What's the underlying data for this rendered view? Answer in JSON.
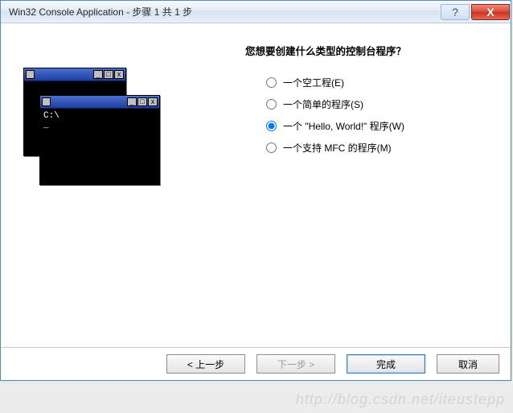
{
  "titlebar": {
    "title": "Win32 Console Application - 步骤 1 共 1 步",
    "help": "?",
    "close": "X"
  },
  "prompt": "您想要创建什么类型的控制台程序？",
  "options": [
    {
      "label": "一个空工程(E)",
      "selected": false
    },
    {
      "label": "一个简单的程序(S)",
      "selected": false
    },
    {
      "label": "一个 \"Hello, World!\" 程序(W)",
      "selected": true
    },
    {
      "label": "一个支持 MFC 的程序(M)",
      "selected": false
    }
  ],
  "illustration": {
    "console_prompt": "C:\\",
    "cursor": "_"
  },
  "buttons": {
    "back": "< 上一步",
    "next": "下一步 >",
    "finish": "完成",
    "cancel": "取消"
  },
  "watermark": "http://blog.csdn.net/iteustepp"
}
